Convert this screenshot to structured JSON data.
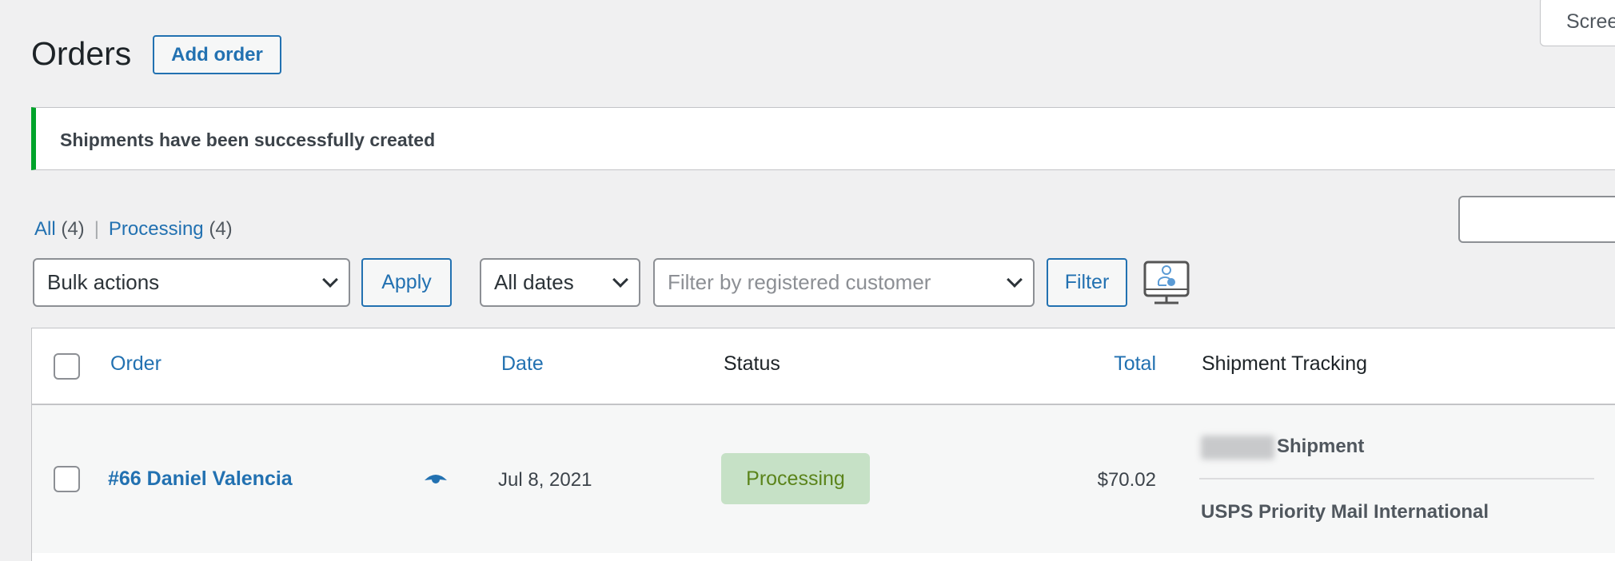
{
  "header": {
    "title": "Orders",
    "add_order_label": "Add order",
    "screen_options_label": "Screen Options"
  },
  "notice": {
    "text": "Shipments have been successfully created",
    "color": "#00a32a"
  },
  "views": [
    {
      "label": "All",
      "count": "(4)"
    },
    {
      "label": "Processing",
      "count": "(4)"
    }
  ],
  "search": {
    "value": ""
  },
  "filters": {
    "bulk_actions": "Bulk actions",
    "apply_label": "Apply",
    "dates": "All dates",
    "customer_placeholder": "Filter by registered customer",
    "filter_label": "Filter",
    "extra_icon": "monitor-user-icon"
  },
  "table": {
    "columns": [
      "Order",
      "Date",
      "Status",
      "Total",
      "Shipment Tracking"
    ],
    "rows": [
      {
        "order": "#66 Daniel Valencia",
        "date": "Jul 8, 2021",
        "status": "Processing",
        "total": "$70.02",
        "tracking_title": "Shipment",
        "tracking_service": "USPS Priority Mail International"
      }
    ]
  },
  "colors": {
    "link": "#2271b1",
    "status_bg": "#c6e1c6",
    "status_text": "#5b841b"
  }
}
